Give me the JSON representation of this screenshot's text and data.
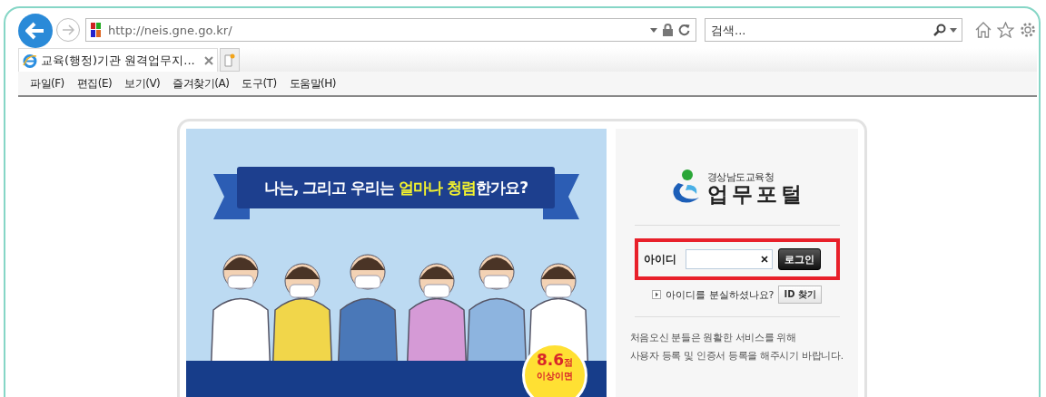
{
  "browser": {
    "address": "http://neis.gne.go.kr/",
    "search": {
      "placeholder": "검색..."
    },
    "tabs": [
      {
        "label": "교육(행정)기관 원격업무지...",
        "selected": true
      }
    ],
    "menu": [
      "파일(F)",
      "편집(E)",
      "보기(V)",
      "즐겨찾기(A)",
      "도구(T)",
      "도움말(H)"
    ]
  },
  "banner": {
    "headline": [
      {
        "text": "나는, 그리고 우리는 ",
        "highlight": false
      },
      {
        "text": "얼마나 청렴",
        "highlight": true
      },
      {
        "text": "한가요?",
        "highlight": false
      }
    ],
    "badge": {
      "score": "8.6",
      "unit": "점",
      "caption": "이상이면"
    }
  },
  "login": {
    "org": "경상남도교육청",
    "title": "업무포털",
    "id_label": "아이디",
    "login_button": "로그인",
    "forgot_text": "아이디를 분실하셨나요?",
    "find_button": "ID 찾기",
    "notice": [
      "처음오신 분들은 원활한 서비스를 위해",
      "사용자 등록 및 인증서 등록을 해주시기 바랍니다."
    ]
  }
}
